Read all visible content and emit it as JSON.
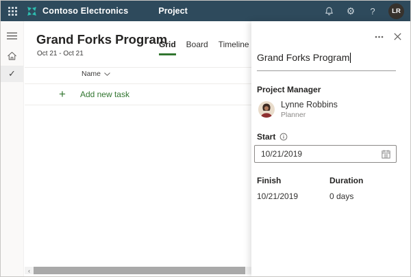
{
  "topbar": {
    "brand": "Contoso Electronics",
    "app_name": "Project",
    "avatar_initials": "LR"
  },
  "icons": {
    "settings_glyph": "⚙",
    "help_glyph": "?",
    "check_glyph": "✓",
    "add_glyph": "+",
    "scroll_left_glyph": "‹"
  },
  "main": {
    "title": "Grand Forks Program",
    "date_range": "Oct 21 - Oct 21",
    "tabs": [
      {
        "label": "Grid",
        "selected": true
      },
      {
        "label": "Board",
        "selected": false
      },
      {
        "label": "Timeline",
        "selected": false
      }
    ],
    "grid": {
      "columns": [
        "Name"
      ],
      "add_task_label": "Add new task"
    }
  },
  "panel": {
    "title_value": "Grand Forks Program",
    "project_manager": {
      "label": "Project Manager",
      "name": "Lynne Robbins",
      "role": "Planner"
    },
    "start": {
      "label": "Start",
      "value": "10/21/2019"
    },
    "finish": {
      "label": "Finish",
      "value": "10/21/2019"
    },
    "duration": {
      "label": "Duration",
      "value": "0 days"
    }
  },
  "colors": {
    "topbar_bg": "#2e4a5c",
    "accent_green": "#31752f",
    "logo_teal": "#2ebdb0",
    "panel_bg": "#ffffff"
  }
}
